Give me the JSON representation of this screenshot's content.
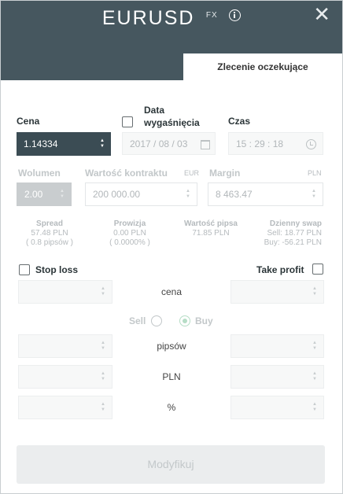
{
  "header": {
    "symbol": "EURUSD",
    "market_tag": "FX",
    "info_icon": "info-icon",
    "close_icon": "close-icon",
    "close_glyph": "✕"
  },
  "tab": {
    "label": "Zlecenie oczekujące"
  },
  "price": {
    "label": "Cena",
    "value": "1.14334"
  },
  "expiry": {
    "label_line1": "Data",
    "label_line2": "wygaśnięcia",
    "date_value": "2017 / 08 / 03",
    "time_label": "Czas",
    "time_value": "15 : 29 : 18"
  },
  "volume": {
    "label": "Wolumen",
    "value": "2.00"
  },
  "contract": {
    "label": "Wartość kontraktu",
    "currency": "EUR",
    "value": "200 000.00"
  },
  "margin": {
    "label": "Margin",
    "currency": "PLN",
    "value": "8 463.47"
  },
  "stats": {
    "spread": {
      "title": "Spread",
      "line1": "57.48 PLN",
      "line2": "( 0.8 pipsów )"
    },
    "commission": {
      "title": "Prowizja",
      "line1": "0.00 PLN",
      "line2": "( 0.0000% )"
    },
    "pip_value": {
      "title": "Wartość pipsa",
      "line1": "71.85 PLN"
    },
    "swap": {
      "title": "Dzienny swap",
      "line1": "Sell: 18.77 PLN",
      "line2": "Buy: -56.21 PLN"
    }
  },
  "stop_loss": {
    "label": "Stop loss",
    "checked": false
  },
  "take_profit": {
    "label": "Take profit",
    "checked": false
  },
  "rows": {
    "price_label": "cena",
    "pips_label": "pipsów",
    "currency_label": "PLN",
    "percent_label": "%"
  },
  "side": {
    "sell_label": "Sell",
    "buy_label": "Buy",
    "selected": "Buy"
  },
  "actions": {
    "modify_label": "Modyfikuj"
  },
  "colors": {
    "header_bg": "#46575f",
    "price_box_bg": "#3b4c54",
    "buy_radio": "#b6ddc6",
    "disabled_text": "#c3c8ca"
  }
}
